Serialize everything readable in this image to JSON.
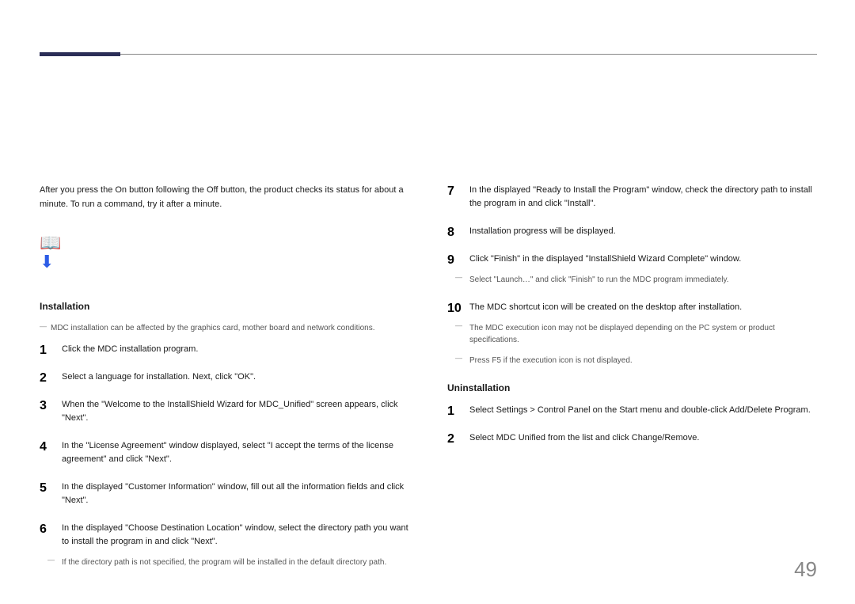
{
  "page_number": "49",
  "intro": "After you press the On button following the Off button, the product checks its status for about a minute. To run a command, try it after a minute.",
  "icon_line1": "📖",
  "icon_line2": "⬇",
  "install_heading": "Installation",
  "uninstall_heading": "Uninstallation",
  "notes": {
    "affects": "MDC installation can be affected by the graphics card, mother board and network conditions.",
    "default_dir": "If the directory path is not specified, the program will be installed in the default directory path.",
    "launch_now": "Select \"Launch…\" and click \"Finish\" to run the MDC program immediately.",
    "icon_not_shown": "The MDC execution icon may not be displayed depending on the PC system or product specifications.",
    "press_f5": "Press F5 if the execution icon is not displayed."
  },
  "left_steps": [
    "Click the MDC installation program.",
    "Select a language for installation. Next, click \"OK\".",
    "When the \"Welcome to the InstallShield Wizard for MDC_Unified\" screen appears, click \"Next\".",
    "In the \"License Agreement\" window displayed, select \"I accept the terms of the license agreement\" and click \"Next\".",
    "In the displayed \"Customer Information\" window, fill out all the information fields and click \"Next\".",
    "In the displayed \"Choose Destination Location\" window, select the directory path you want to install the program in and click \"Next\"."
  ],
  "right_steps": [
    "In the displayed \"Ready to Install the Program\" window, check the directory path to install the program in and click \"Install\".",
    "Installation progress will be displayed.",
    "Click \"Finish\" in the displayed \"InstallShield Wizard Complete\" window.",
    "The MDC shortcut icon will be created on the desktop after installation."
  ],
  "uninstall_steps": [
    "Select Settings > Control Panel on the Start menu and double-click Add/Delete Program.",
    "Select MDC Unified from the list and click Change/Remove."
  ]
}
